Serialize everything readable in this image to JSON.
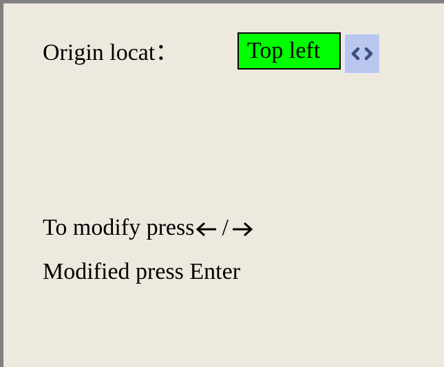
{
  "origin": {
    "label": "Origin locat：",
    "value": "Top left",
    "stepper_icon": "left-right-chevrons-icon",
    "value_bg_color": "#00ff00",
    "stepper_bg_color": "#b9c6ee"
  },
  "hints": {
    "modify_prefix": "To modify press",
    "left_arrow_icon": "arrow-left-icon",
    "separator": "/",
    "right_arrow_icon": "arrow-right-icon",
    "enter_text": "Modified press Enter"
  },
  "theme": {
    "screen_bg": "#ede9df",
    "frame_color": "#808080"
  }
}
